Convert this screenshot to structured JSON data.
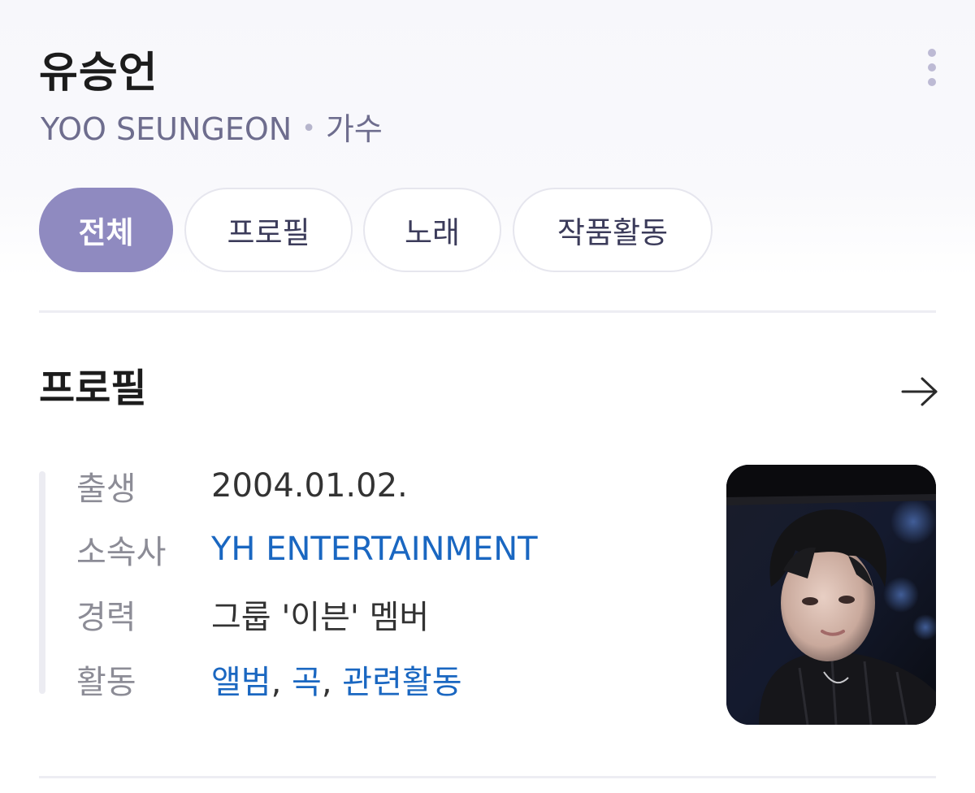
{
  "header": {
    "name": "유승언",
    "english_name": "YOO SEUNGEON",
    "separator": "•",
    "occupation": "가수",
    "more_icon": "more-vertical-icon"
  },
  "tabs": [
    {
      "label": "전체",
      "active": true
    },
    {
      "label": "프로필",
      "active": false
    },
    {
      "label": "노래",
      "active": false
    },
    {
      "label": "작품활동",
      "active": false
    }
  ],
  "profile": {
    "title": "프로필",
    "arrow_icon": "arrow-right-icon",
    "rows": [
      {
        "label": "출생",
        "value": "2004.01.02."
      },
      {
        "label": "소속사",
        "value": "YH ENTERTAINMENT"
      },
      {
        "label": "경력",
        "value": "그룹 '이븐' 멤버"
      },
      {
        "label": "활동",
        "links": [
          "앨범",
          "곡",
          "관련활동"
        ],
        "separator": ", "
      }
    ],
    "photo_icon": "profile-photo"
  },
  "colors": {
    "accent": "#8f8ac0",
    "link": "#1a67c1",
    "subtitle": "#6e6d8e",
    "label": "#8c8c96"
  }
}
